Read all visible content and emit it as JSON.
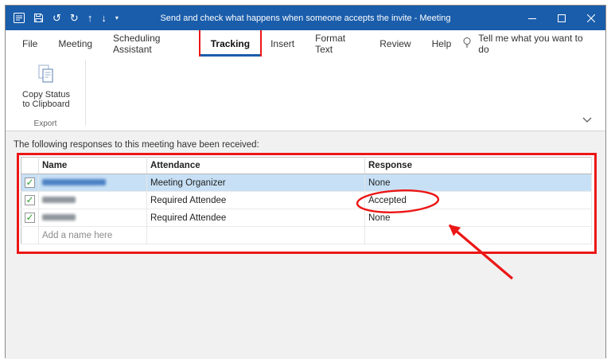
{
  "colors": {
    "title_bar": "#1a5dab",
    "accent": "#1a5dab",
    "annotation": "#ec1616",
    "check_green": "#2f9e2f",
    "selection_blue": "#c7e0f5"
  },
  "glyphs": {
    "undo": "↺",
    "redo": "↻",
    "up": "↑",
    "down": "↓",
    "caret": "▾"
  },
  "window": {
    "title": "Send and check what happens when someone accepts the invite - Meeting"
  },
  "ribbon": {
    "tabs": [
      {
        "label": "File"
      },
      {
        "label": "Meeting"
      },
      {
        "label": "Scheduling Assistant"
      },
      {
        "label": "Tracking",
        "active": true
      },
      {
        "label": "Insert"
      },
      {
        "label": "Format Text"
      },
      {
        "label": "Review"
      },
      {
        "label": "Help"
      }
    ],
    "tell_me": "Tell me what you want to do",
    "copy_status": {
      "line1": "Copy Status",
      "line2": "to Clipboard"
    },
    "group_label": "Export"
  },
  "main": {
    "intro": "The following responses to this meeting have been received:",
    "table": {
      "headers": [
        "Name",
        "Attendance",
        "Response"
      ],
      "rows": [
        {
          "name_blurred": true,
          "name_style": "link",
          "attendance": "Meeting Organizer",
          "response": "None",
          "checked": true,
          "selected": true
        },
        {
          "name_blurred": true,
          "name_style": "gray",
          "attendance": "Required Attendee",
          "response": "Accepted",
          "checked": true,
          "circled": true
        },
        {
          "name_blurred": true,
          "name_style": "gray",
          "attendance": "Required Attendee",
          "response": "None",
          "checked": true
        },
        {
          "name": "Add a name here",
          "placeholder": true
        }
      ]
    }
  }
}
